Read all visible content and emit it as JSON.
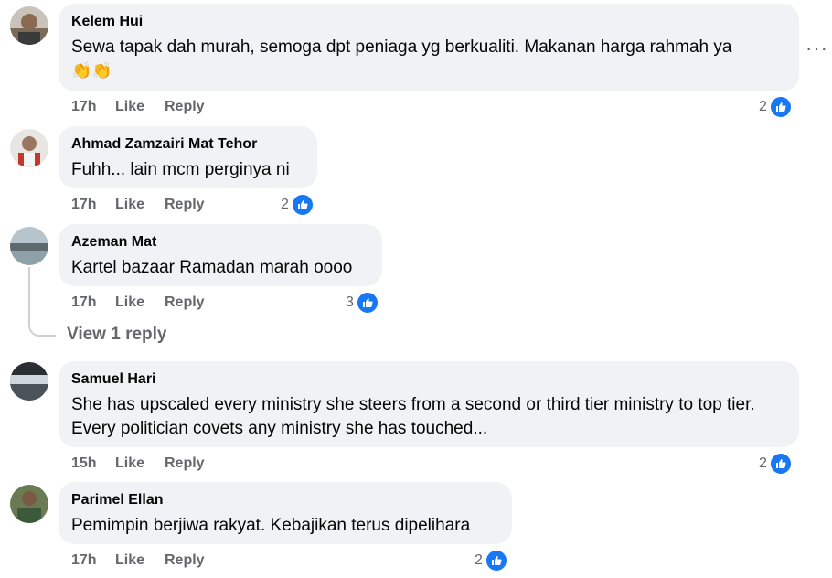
{
  "comments": [
    {
      "author": "Kelem Hui",
      "text": "Sewa tapak dah murah, semoga dpt peniaga yg berkualiti. Makanan harga rahmah ya",
      "emoji": "👏👏",
      "time": "17h",
      "like": "Like",
      "reply": "Reply",
      "reactions": "2"
    },
    {
      "author": "Ahmad Zamzairi Mat Tehor",
      "text": "Fuhh... lain mcm perginya ni",
      "time": "17h",
      "like": "Like",
      "reply": "Reply",
      "reactions": "2"
    },
    {
      "author": "Azeman Mat",
      "text": "Kartel bazaar Ramadan marah oooo",
      "time": "17h",
      "like": "Like",
      "reply": "Reply",
      "reactions": "3"
    },
    {
      "author": "Samuel Hari",
      "text": "She has upscaled every ministry she steers from a second or third tier ministry to top tier. Every politician covets any ministry she has touched...",
      "time": "15h",
      "like": "Like",
      "reply": "Reply",
      "reactions": "2"
    },
    {
      "author": "Parimel Ellan",
      "text": "Pemimpin berjiwa rakyat. Kebajikan terus dipelihara",
      "time": "17h",
      "like": "Like",
      "reply": "Reply",
      "reactions": "2"
    }
  ],
  "view_replies": "View 1 reply",
  "more_icon": "more-horizontal-icon",
  "reaction_icon": "thumbs-up-icon",
  "colors": {
    "like_blue": "#1877f2",
    "bubble": "#f0f2f5",
    "muted": "#65676b"
  }
}
